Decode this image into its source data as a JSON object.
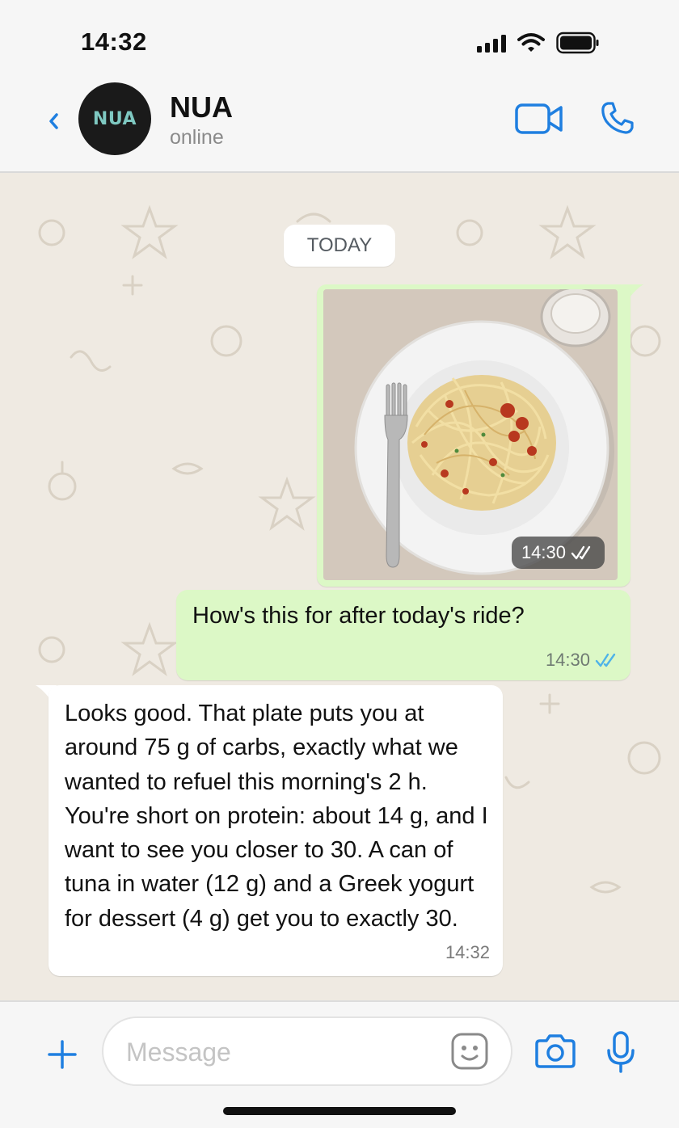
{
  "status_bar": {
    "time": "14:32"
  },
  "header": {
    "avatar_text": "NUA",
    "contact_name": "NUA",
    "contact_status": "online",
    "accent_color": "#1f7fe0"
  },
  "chat": {
    "date_chip": "TODAY",
    "messages": [
      {
        "type": "image",
        "direction": "outgoing",
        "time": "14:30",
        "status": "read"
      },
      {
        "type": "text",
        "direction": "outgoing",
        "text": "How's this for after today's ride?",
        "time": "14:30",
        "status": "read"
      },
      {
        "type": "text",
        "direction": "incoming",
        "text": "Looks good. That plate puts you at around 75 g of carbs, exactly what we wanted to refuel this morning's 2 h. You're short on protein: about 14 g, and I want to see you closer to 30. A can of tuna in water (12 g) and a Greek yogurt for dessert (4 g) get you to exactly 30.",
        "time": "14:32"
      }
    ],
    "outgoing_bubble_color": "#dcf8c6",
    "incoming_bubble_color": "#ffffff"
  },
  "input_bar": {
    "placeholder": "Message",
    "value": ""
  }
}
